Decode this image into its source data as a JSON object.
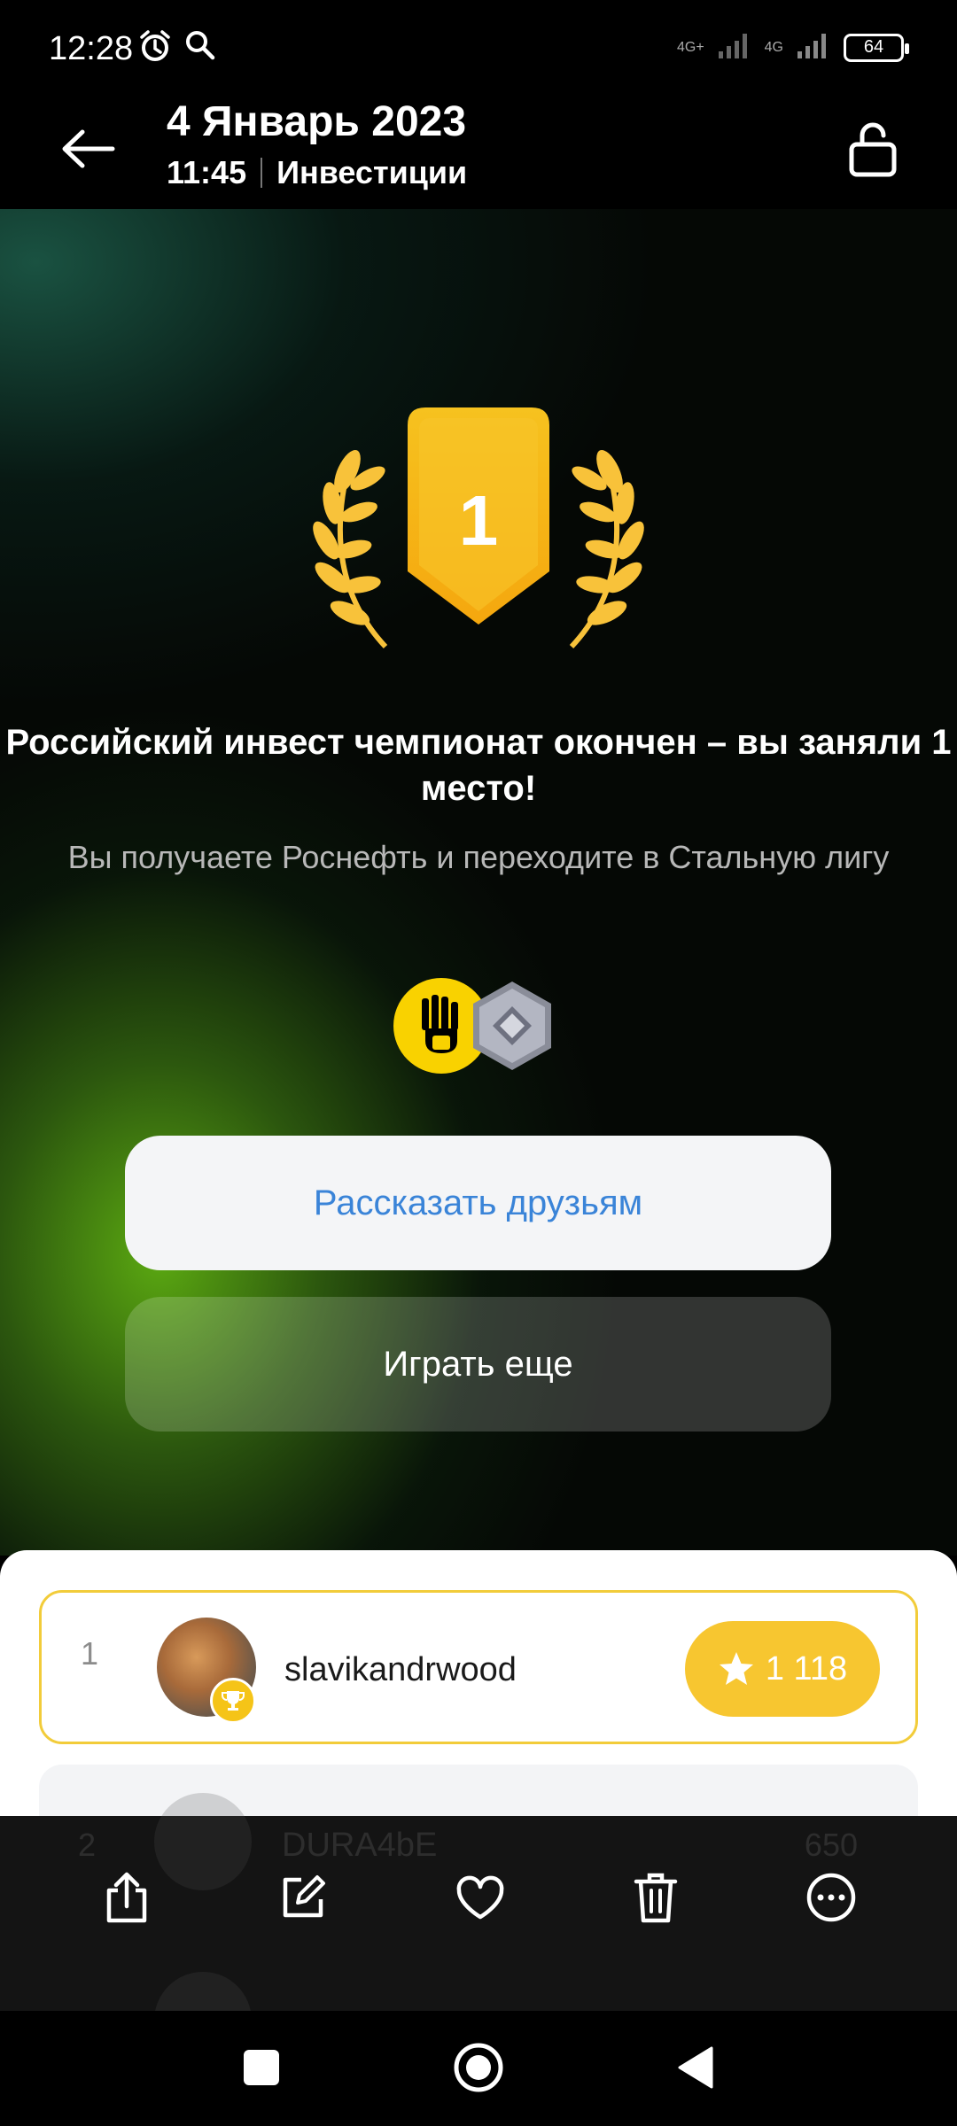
{
  "status_bar": {
    "time": "12:28",
    "network_1": "4G+",
    "network_2": "4G",
    "battery": "64"
  },
  "header": {
    "date": "4 Январь 2023",
    "time": "11:45",
    "category": "Инвестиции"
  },
  "award": {
    "place": "1",
    "medal_color": "#f6be22"
  },
  "result": {
    "title": "Российский инвест чемпионат окончен – вы заняли 1 место!",
    "subtitle": "Вы получаете Роснефть и переходите в Стальную лигу"
  },
  "rewards": [
    {
      "name": "rosneft-logo-icon"
    },
    {
      "name": "steel-league-icon"
    }
  ],
  "buttons": {
    "share": "Рассказать друзьям",
    "play_again": "Играть еще"
  },
  "leaderboard": {
    "rows": [
      {
        "rank": "1",
        "username": "slavikandrwood",
        "score": "1 118",
        "highlight_color": "#f2cc3a"
      },
      {
        "rank": "2",
        "username": "DURA4bE",
        "score": "650"
      }
    ]
  },
  "toolbar": {
    "items": [
      "share-icon",
      "edit-icon",
      "heart-icon",
      "trash-icon",
      "more-icon"
    ]
  },
  "navbar": {
    "items": [
      "recent-apps-icon",
      "home-icon",
      "back-icon"
    ]
  }
}
